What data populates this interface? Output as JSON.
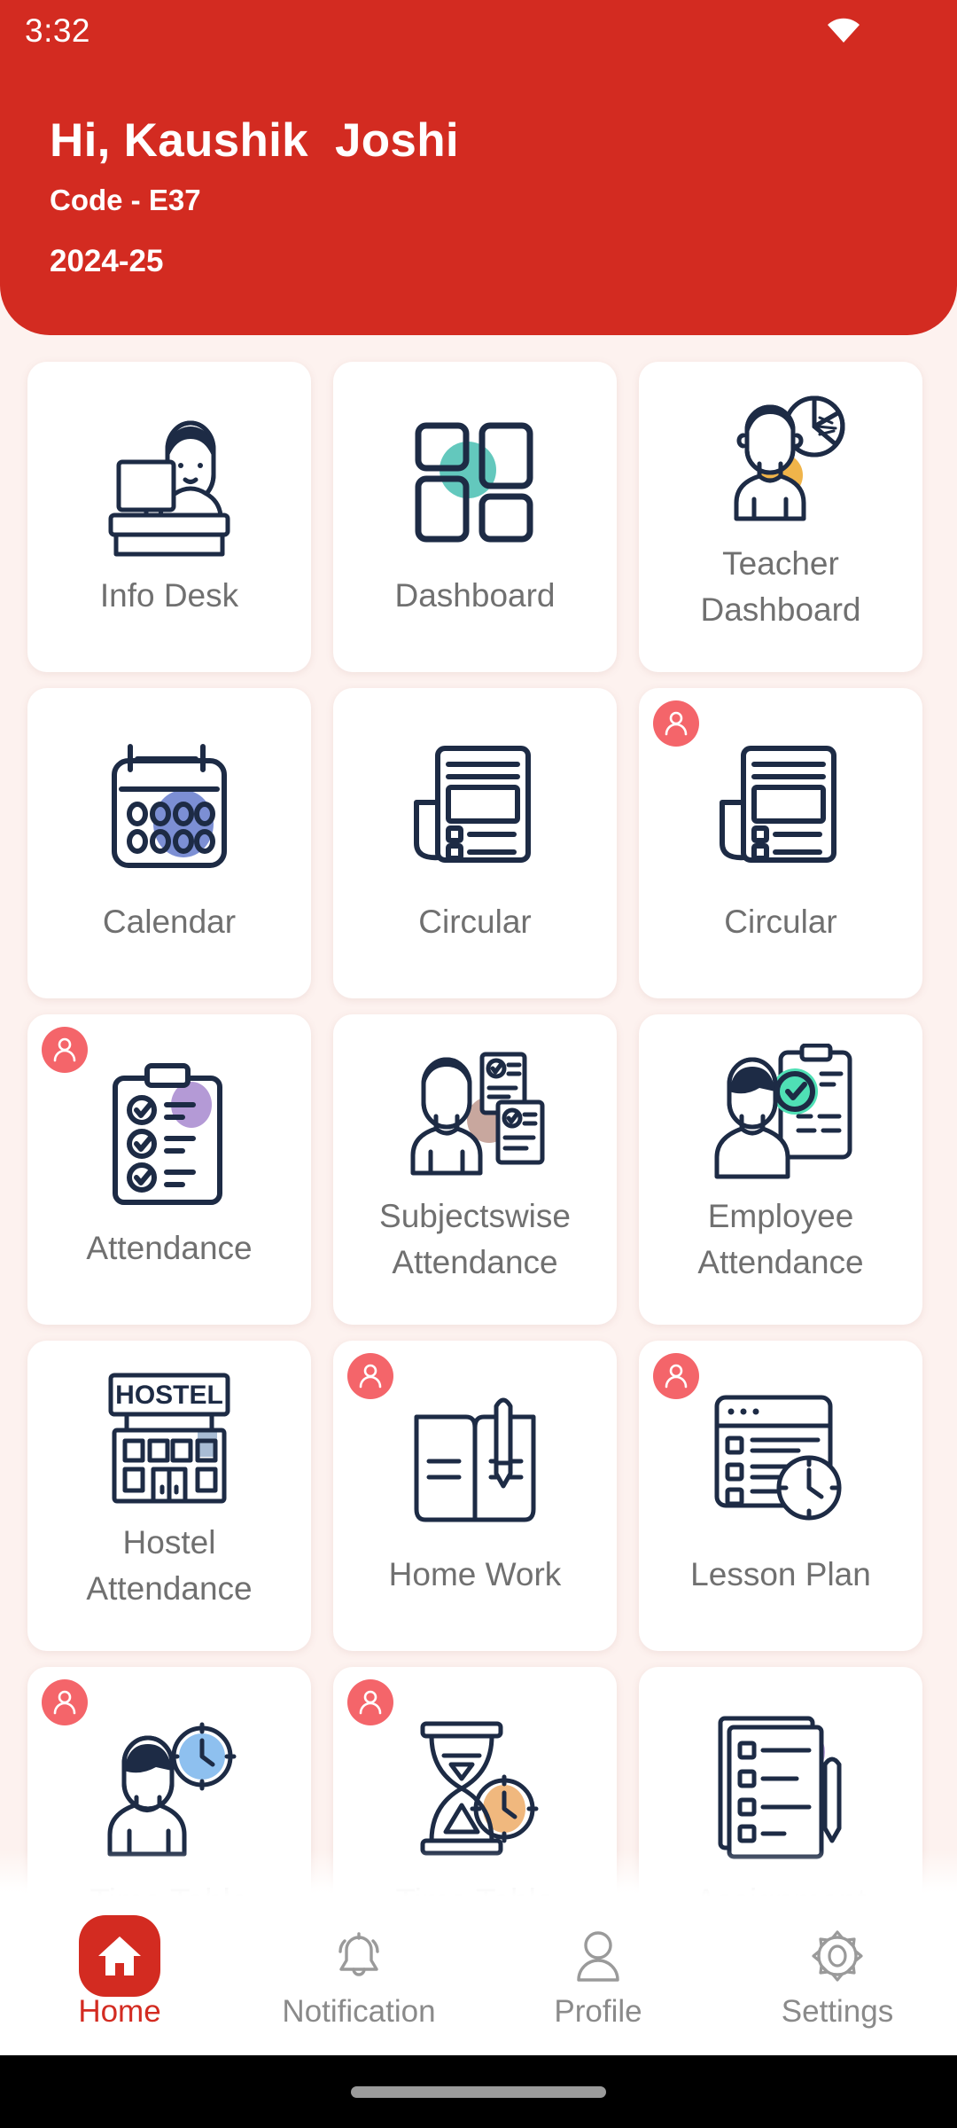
{
  "status_bar": {
    "time": "3:32",
    "wifi_icon": "wifi-icon"
  },
  "header": {
    "greeting": "Hi, Kaushik  Joshi",
    "code": "Code - E37",
    "academic_year": "2024-25",
    "background_color": "#d32b21",
    "text_color": "#ffffff"
  },
  "colors": {
    "primary": "#d32b21",
    "page_background": "#fdf2ef",
    "card_background": "#ffffff",
    "label_text": "#707070",
    "icon_stroke": "#1d2b45",
    "badge": "#f4656a"
  },
  "grid": {
    "columns": 3,
    "items": [
      {
        "label": "Info Desk",
        "icon": "info-desk-icon",
        "badge": false,
        "two_line": false
      },
      {
        "label": "Dashboard",
        "icon": "dashboard-grid-icon",
        "badge": false,
        "two_line": false
      },
      {
        "label": "Teacher\nDashboard",
        "icon": "teacher-dashboard-icon",
        "badge": false,
        "two_line": true
      },
      {
        "label": "Calendar",
        "icon": "calendar-icon",
        "badge": false,
        "two_line": false
      },
      {
        "label": "Circular",
        "icon": "circular-document-icon",
        "badge": false,
        "two_line": false
      },
      {
        "label": "Circular",
        "icon": "circular-document-icon",
        "badge": true,
        "two_line": false
      },
      {
        "label": "Attendance",
        "icon": "attendance-clipboard-icon",
        "badge": true,
        "two_line": false
      },
      {
        "label": "Subjectswise\nAttendance",
        "icon": "subjectswise-attendance-icon",
        "badge": false,
        "two_line": true
      },
      {
        "label": "Employee\nAttendance",
        "icon": "employee-attendance-icon",
        "badge": false,
        "two_line": true
      },
      {
        "label": "Hostel\nAttendance",
        "icon": "hostel-building-icon",
        "badge": false,
        "two_line": true
      },
      {
        "label": "Home Work",
        "icon": "home-work-book-icon",
        "badge": true,
        "two_line": false
      },
      {
        "label": "Lesson Plan",
        "icon": "lesson-plan-icon",
        "badge": true,
        "two_line": false
      },
      {
        "label": "Time Table",
        "icon": "time-table-person-clock-icon",
        "badge": true,
        "two_line": false
      },
      {
        "label": "Time Table",
        "icon": "time-table-hourglass-icon",
        "badge": true,
        "two_line": false
      },
      {
        "label": "Assignment",
        "icon": "assignment-pen-icon",
        "badge": false,
        "two_line": false
      }
    ]
  },
  "bottom_nav": {
    "items": [
      {
        "label": "Home",
        "icon": "home-icon",
        "active": true
      },
      {
        "label": "Notification",
        "icon": "bell-icon",
        "active": false
      },
      {
        "label": "Profile",
        "icon": "person-icon",
        "active": false
      },
      {
        "label": "Settings",
        "icon": "gear-icon",
        "active": false
      }
    ]
  }
}
